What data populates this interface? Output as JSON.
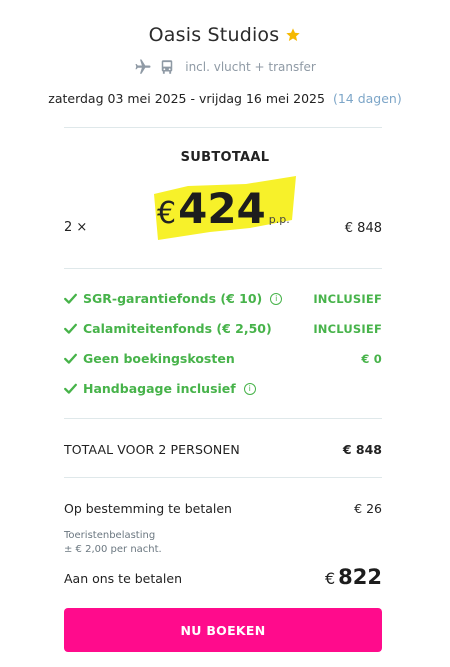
{
  "header": {
    "hotel_name": "Oasis Studios",
    "rating_icon": "star-icon",
    "transport_text": "incl. vlucht + transfer",
    "transport_icons": [
      "plane-icon",
      "bus-icon"
    ],
    "dates": "zaterdag 03 mei 2025 - vrijdag 16 mei 2025",
    "duration": "(14 dagen)"
  },
  "subtotal": {
    "label": "SUBTOTAAL",
    "quantity": "2 ×",
    "currency": "€",
    "price_per_person": "424",
    "pp_suffix": "p.p.",
    "line_total": "€ 848"
  },
  "inclusions": [
    {
      "label": "SGR-garantiefonds (€ 10)",
      "has_info": true,
      "value": "INCLUSIEF"
    },
    {
      "label": "Calamiteitenfonds  (€ 2,50)",
      "has_info": false,
      "value": "INCLUSIEF"
    },
    {
      "label": "Geen boekingskosten",
      "has_info": false,
      "value": "€ 0"
    },
    {
      "label": "Handbagage inclusief",
      "has_info": true,
      "value": ""
    }
  ],
  "total": {
    "label": "TOTAAL VOOR 2 PERSONEN",
    "value": "€ 848"
  },
  "destination": {
    "label": "Op bestemming te betalen",
    "value": "€ 26",
    "tax_note_line1": "Toeristenbelasting",
    "tax_note_line2": "± € 2,00 per nacht."
  },
  "payment": {
    "label": "Aan ons te betalen",
    "currency": "€",
    "amount": "822"
  },
  "cta": {
    "label": "NU BOEKEN"
  },
  "colors": {
    "accent_pink": "#ff0b8c",
    "success_green": "#47b34a",
    "highlight_yellow": "#f7f12a",
    "star_gold": "#f5b800",
    "muted_blue": "#7da6c8"
  }
}
